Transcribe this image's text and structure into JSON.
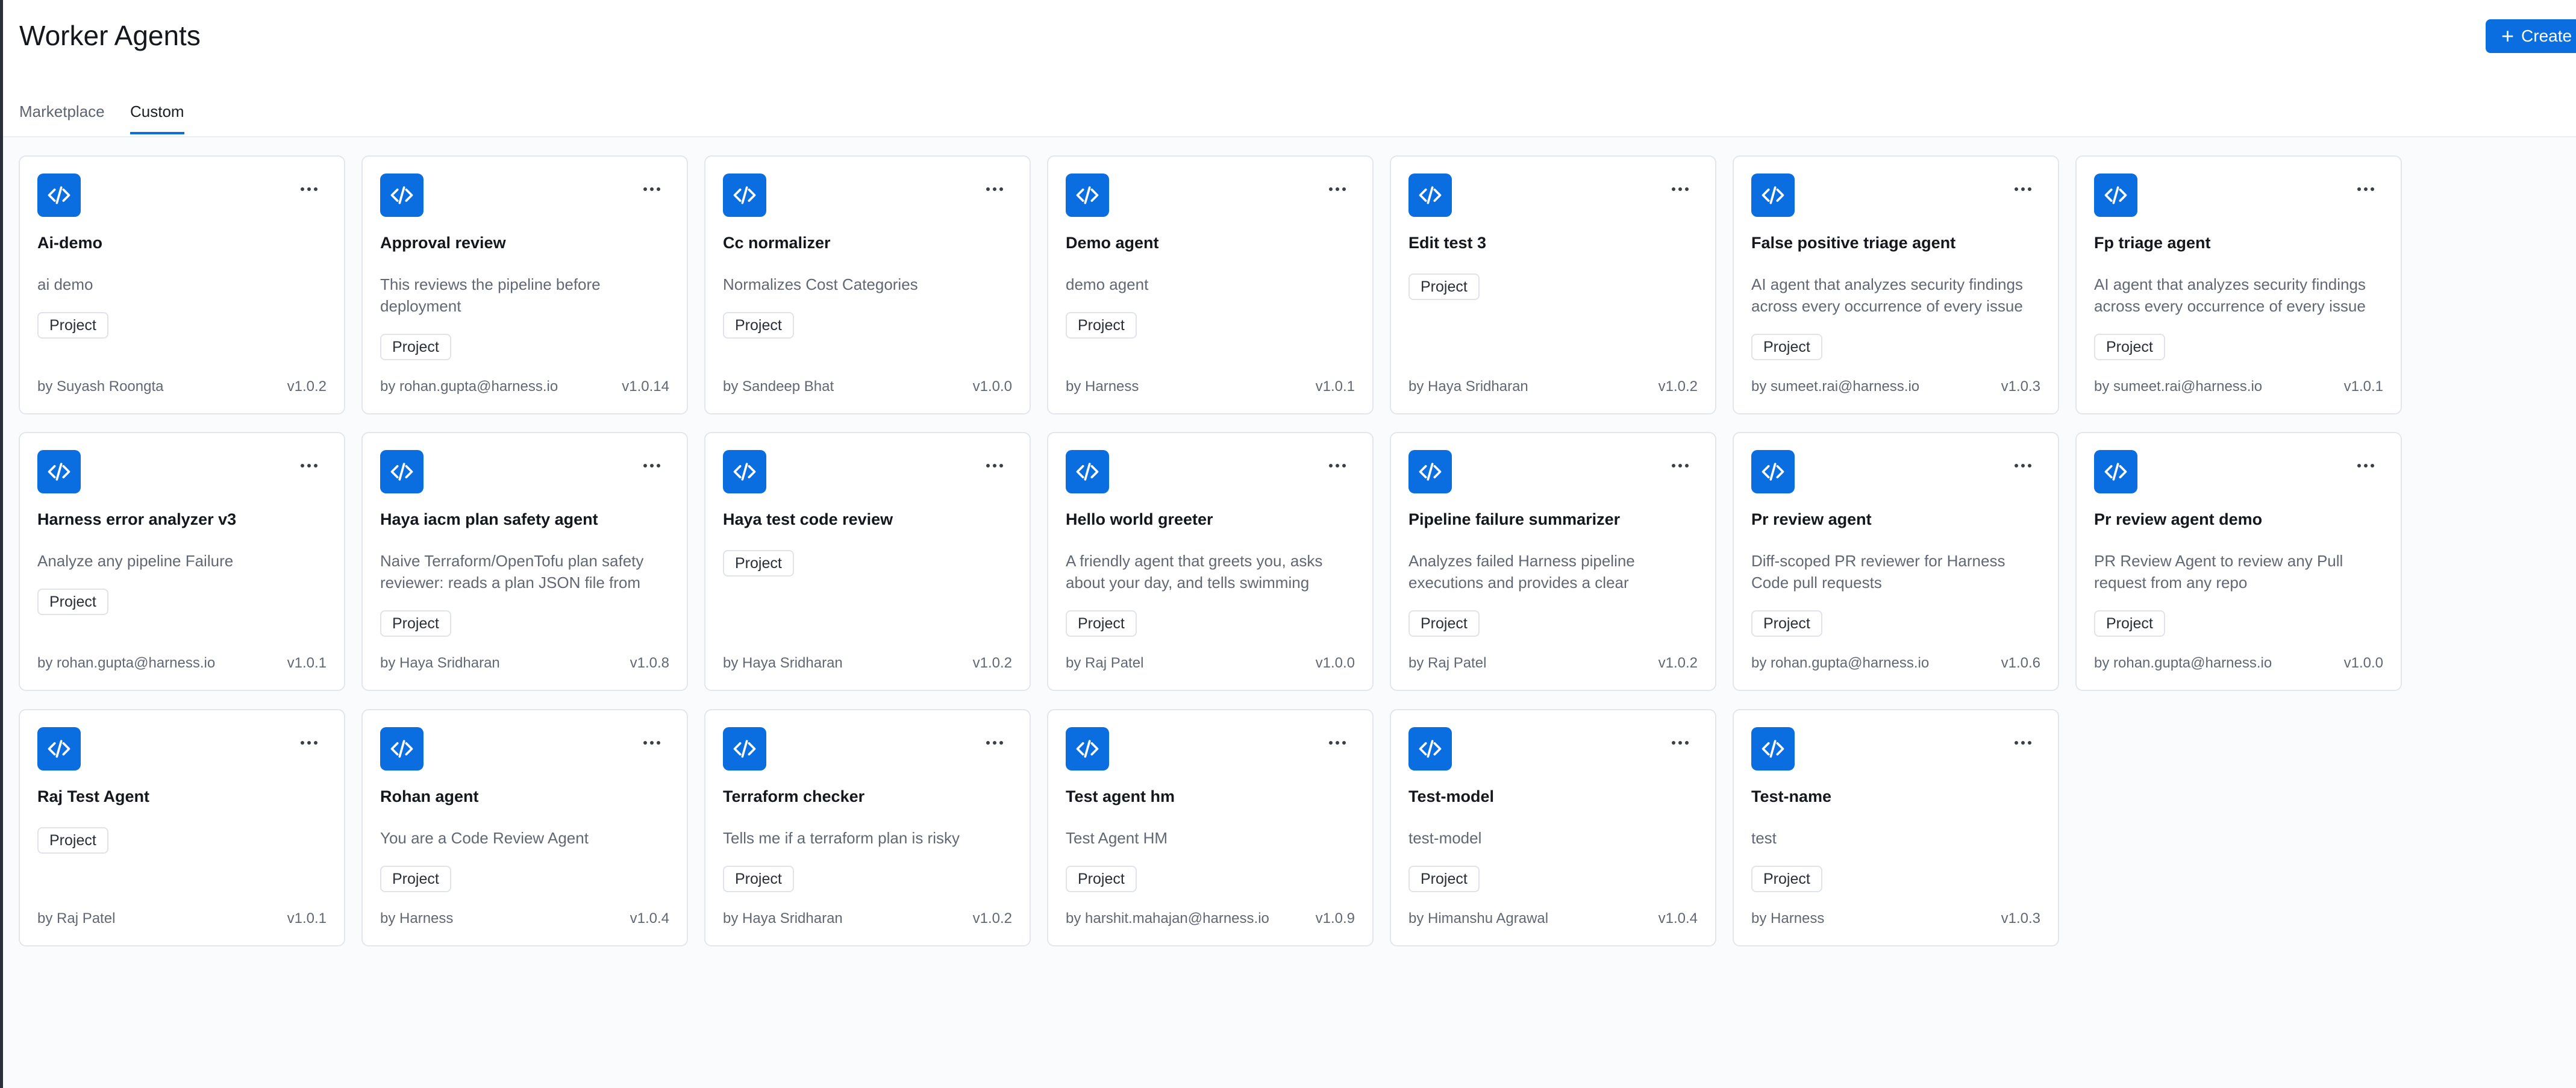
{
  "page": {
    "title": "Worker Agents",
    "create_label": "Create"
  },
  "tabs": [
    {
      "label": "Marketplace",
      "active": false
    },
    {
      "label": "Custom",
      "active": true
    }
  ],
  "colors": {
    "accent": "#0b6ee0"
  },
  "icons": {
    "agent": "code-brackets-icon",
    "menu": "more-horizontal-icon",
    "create": "plus-icon"
  },
  "agents": [
    {
      "title": "Ai-demo",
      "description": "ai demo",
      "badge": "Project",
      "author": "by Suyash Roongta",
      "version": "v1.0.2"
    },
    {
      "title": "Approval review",
      "description": "This reviews the pipeline before deployment",
      "badge": "Project",
      "author": "by rohan.gupta@harness.io",
      "version": "v1.0.14"
    },
    {
      "title": "Cc normalizer",
      "description": "Normalizes Cost Categories",
      "badge": "Project",
      "author": "by Sandeep Bhat",
      "version": "v1.0.0"
    },
    {
      "title": "Demo agent",
      "description": "demo agent",
      "badge": "Project",
      "author": "by Harness",
      "version": "v1.0.1"
    },
    {
      "title": "Edit test 3",
      "description": "",
      "badge": "Project",
      "author": "by Haya Sridharan",
      "version": "v1.0.2"
    },
    {
      "title": "False positive triage agent",
      "description": "AI agent that analyzes security findings across every occurrence of every issue ...",
      "badge": "Project",
      "author": "by sumeet.rai@harness.io",
      "version": "v1.0.3"
    },
    {
      "title": "Fp triage agent",
      "description": "AI agent that analyzes security findings across every occurrence of every issue ...",
      "badge": "Project",
      "author": "by sumeet.rai@harness.io",
      "version": "v1.0.1"
    },
    {
      "title": "Harness error analyzer v3",
      "description": "Analyze any pipeline Failure",
      "badge": "Project",
      "author": "by rohan.gupta@harness.io",
      "version": "v1.0.1"
    },
    {
      "title": "Haya iacm plan safety agent",
      "description": "Naive Terraform/OpenTofu plan safety reviewer: reads a plan JSON file from th...",
      "badge": "Project",
      "author": "by Haya Sridharan",
      "version": "v1.0.8"
    },
    {
      "title": "Haya test code review",
      "description": "",
      "badge": "Project",
      "author": "by Haya Sridharan",
      "version": "v1.0.2"
    },
    {
      "title": "Hello world greeter",
      "description": "A friendly agent that greets you, asks about your day, and tells swimming jokes",
      "badge": "Project",
      "author": "by Raj Patel",
      "version": "v1.0.0"
    },
    {
      "title": "Pipeline failure summarizer",
      "description": "Analyzes failed Harness pipeline executions and provides a clear summa...",
      "badge": "Project",
      "author": "by Raj Patel",
      "version": "v1.0.2"
    },
    {
      "title": "Pr review agent",
      "description": "Diff-scoped PR reviewer for Harness Code pull requests",
      "badge": "Project",
      "author": "by rohan.gupta@harness.io",
      "version": "v1.0.6"
    },
    {
      "title": "Pr review agent demo",
      "description": "PR Review Agent to review any Pull request from any repo",
      "badge": "Project",
      "author": "by rohan.gupta@harness.io",
      "version": "v1.0.0"
    },
    {
      "title": "Raj Test Agent",
      "description": "",
      "badge": "Project",
      "author": "by Raj Patel",
      "version": "v1.0.1"
    },
    {
      "title": "Rohan agent",
      "description": "You are a Code Review Agent",
      "badge": "Project",
      "author": "by Harness",
      "version": "v1.0.4"
    },
    {
      "title": "Terraform checker",
      "description": "Tells me if a terraform plan is risky",
      "badge": "Project",
      "author": "by Haya Sridharan",
      "version": "v1.0.2"
    },
    {
      "title": "Test agent hm",
      "description": "Test Agent HM",
      "badge": "Project",
      "author": "by harshit.mahajan@harness.io",
      "version": "v1.0.9"
    },
    {
      "title": "Test-model",
      "description": "test-model",
      "badge": "Project",
      "author": "by Himanshu Agrawal",
      "version": "v1.0.4"
    },
    {
      "title": "Test-name",
      "description": "test",
      "badge": "Project",
      "author": "by Harness",
      "version": "v1.0.3"
    }
  ]
}
